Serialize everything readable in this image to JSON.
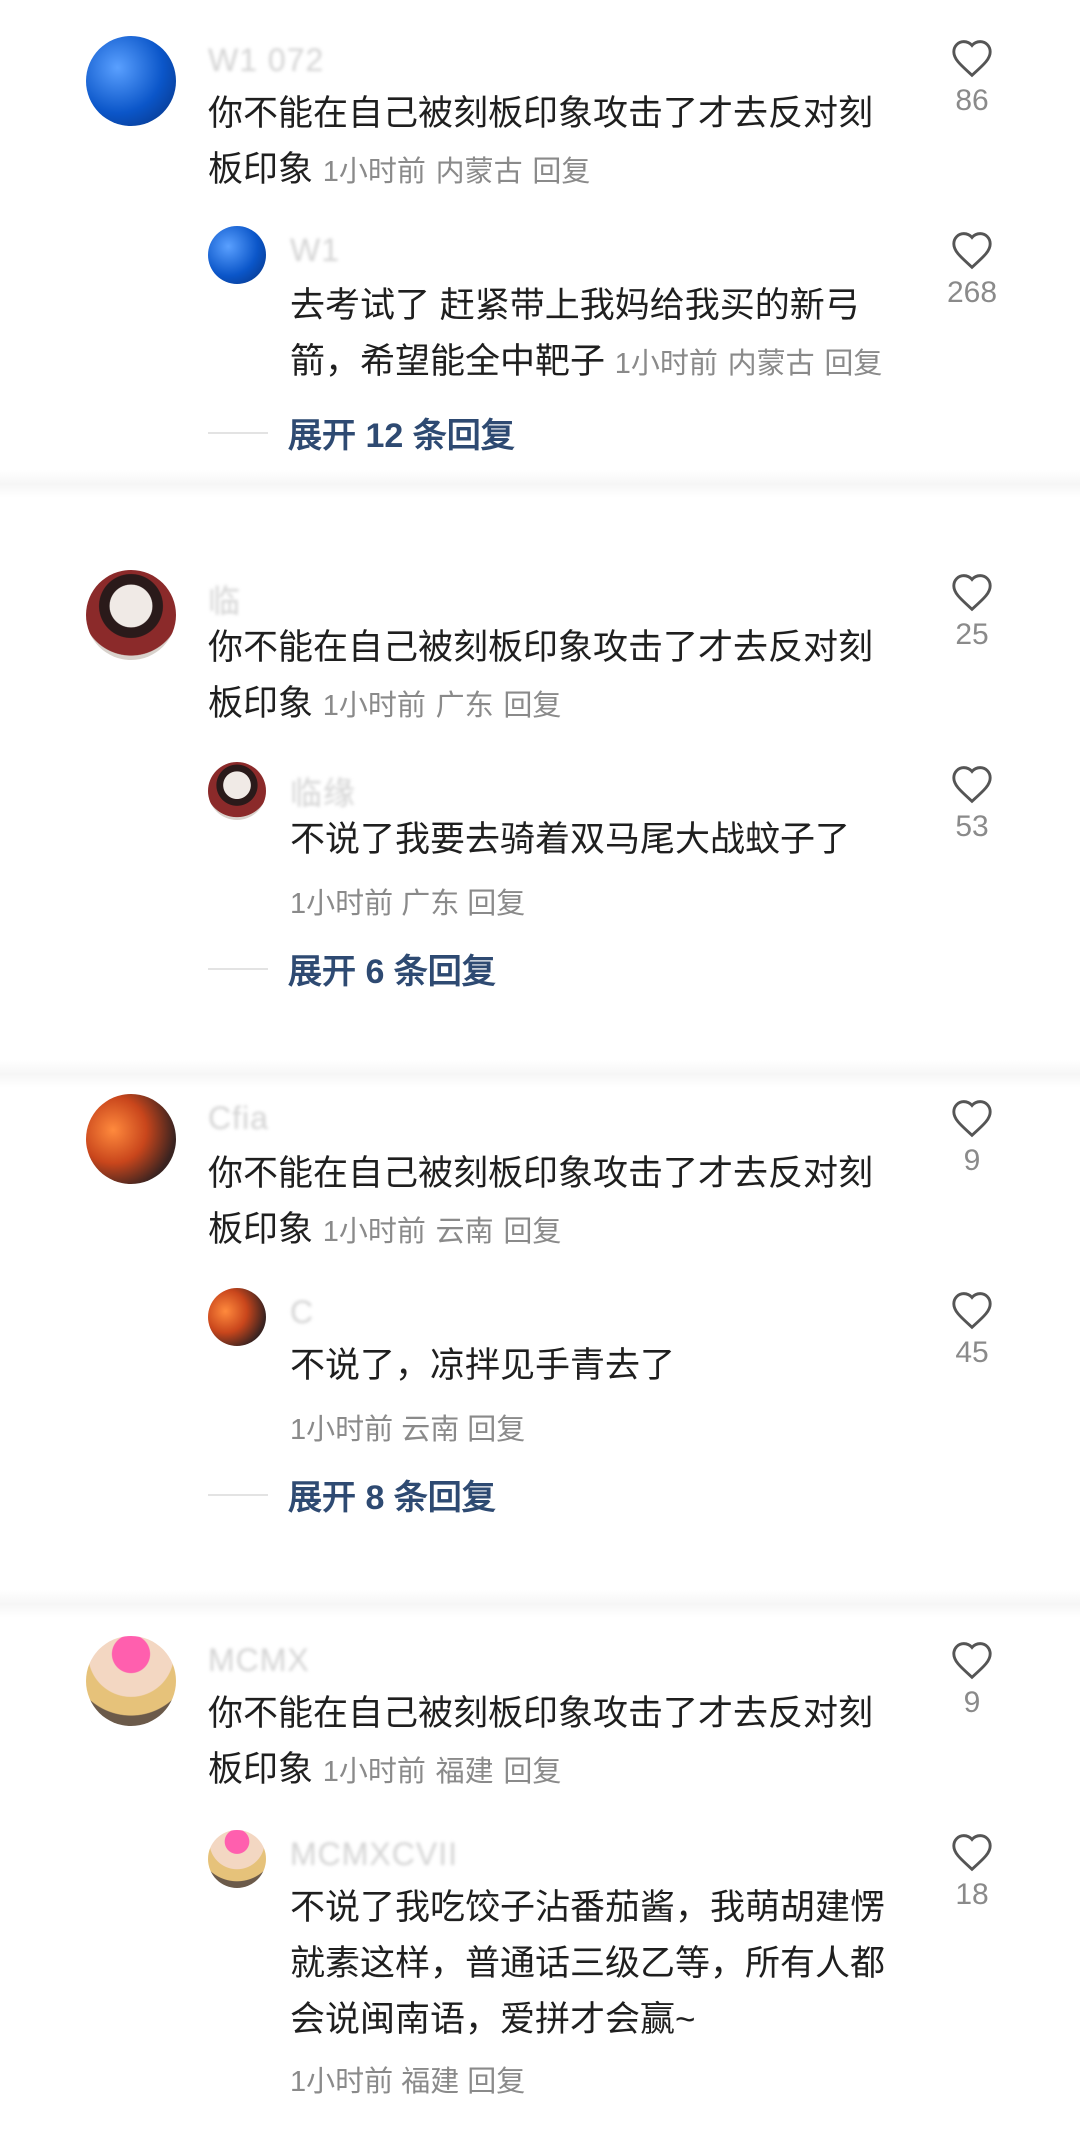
{
  "colors": {
    "link": "#2e4a72",
    "meta": "#8a8a8a",
    "text": "#1f1f1f",
    "username": "#d3d3d3"
  },
  "threads": [
    {
      "comment": {
        "username": "W1 072",
        "text_a": "你不能在自己被刻板印象攻击了才去反对刻",
        "text_b": "板印象",
        "time": "1小时前",
        "location": "内蒙古",
        "reply": "回复",
        "likes": "86"
      },
      "reply": {
        "username": "W1",
        "text_a": "去考试了  赶紧带上我妈给我买的新弓",
        "text_b": "箭，希望能全中靶子",
        "time": "1小时前",
        "location": "内蒙古",
        "reply": "回复",
        "likes": "268"
      },
      "expand": "展开 12 条回复"
    },
    {
      "comment": {
        "username": "临",
        "text_a": "你不能在自己被刻板印象攻击了才去反对刻",
        "text_b": "板印象",
        "time": "1小时前",
        "location": "广东",
        "reply": "回复",
        "likes": "25"
      },
      "reply": {
        "username": "临缘",
        "text_a": "不说了我要去骑着双马尾大战蚊子了",
        "time": "1小时前",
        "location": "广东",
        "reply": "回复",
        "likes": "53"
      },
      "expand": "展开 6 条回复"
    },
    {
      "comment": {
        "username": "Cfia",
        "text_a": "你不能在自己被刻板印象攻击了才去反对刻",
        "text_b": "板印象",
        "time": "1小时前",
        "location": "云南",
        "reply": "回复",
        "likes": "9"
      },
      "reply": {
        "username": "C",
        "text_a": "不说了，凉拌见手青去了",
        "time": "1小时前",
        "location": "云南",
        "reply": "回复",
        "likes": "45"
      },
      "expand": "展开 8 条回复"
    },
    {
      "comment": {
        "username": "MCMX",
        "text_a": "你不能在自己被刻板印象攻击了才去反对刻",
        "text_b": "板印象",
        "time": "1小时前",
        "location": "福建",
        "reply": "回复",
        "likes": "9"
      },
      "reply": {
        "username": "MCMXCVII",
        "text_a": "不说了我吃饺子沾番茄酱，我萌胡建愣",
        "text_b": "就素这样，普通话三级乙等，所有人都",
        "text_c": "会说闽南语，爱拼才会赢~",
        "time": "1小时前",
        "location": "福建",
        "reply": "回复",
        "likes": "18"
      }
    }
  ]
}
